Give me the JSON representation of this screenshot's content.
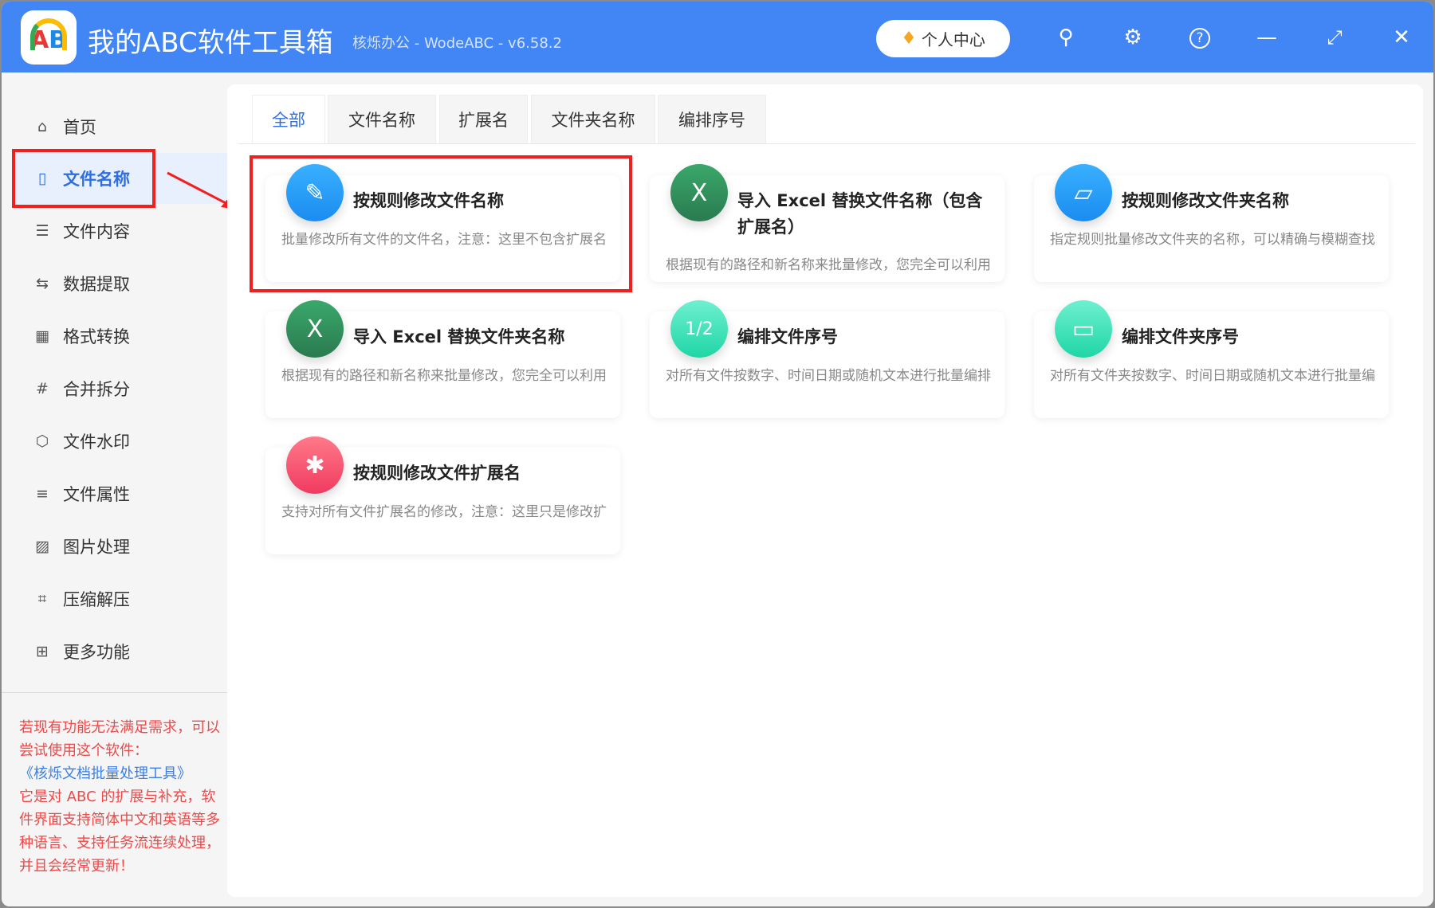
{
  "header": {
    "logo_text": "AB",
    "title": "我的ABC软件工具箱",
    "subtitle": "核烁办公 - WodeABC - v6.58.2",
    "vip_label": "个人中心",
    "icons": [
      "search-icon",
      "gear-icon",
      "help-icon",
      "minimize-icon",
      "maximize-icon",
      "close-icon"
    ]
  },
  "sidebar": {
    "items": [
      {
        "label": "首页",
        "icon": "⌂"
      },
      {
        "label": "文件名称",
        "icon": "▯"
      },
      {
        "label": "文件内容",
        "icon": "☰"
      },
      {
        "label": "数据提取",
        "icon": "⇆"
      },
      {
        "label": "格式转换",
        "icon": "▦"
      },
      {
        "label": "合并拆分",
        "icon": "#"
      },
      {
        "label": "文件水印",
        "icon": "⬡"
      },
      {
        "label": "文件属性",
        "icon": "≡"
      },
      {
        "label": "图片处理",
        "icon": "▨"
      },
      {
        "label": "压缩解压",
        "icon": "⌗"
      },
      {
        "label": "更多功能",
        "icon": "⊞"
      }
    ],
    "active_index": 1,
    "promo": {
      "line1": "若现有功能无法满足需求，可以尝试使用这个软件：",
      "link": "《核烁文档批量处理工具》",
      "line2": "它是对 ABC 的扩展与补充，软件界面支持简体中文和英语等多种语言、支持任务流连续处理，并且会经常更新！"
    }
  },
  "tabs": [
    "全部",
    "文件名称",
    "扩展名",
    "文件夹名称",
    "编排序号"
  ],
  "active_tab": 0,
  "cards": [
    {
      "title": "按规则修改文件名称",
      "desc": "批量修改所有文件的文件名，注意：这里不包含扩展名",
      "color": "#1e9bf5"
    },
    {
      "title": "导入 Excel 替换文件名称（包含扩展名）",
      "desc": "根据现有的路径和新名称来批量修改，您完全可以利用Excel",
      "color": "#2e8b57"
    },
    {
      "title": "按规则修改文件夹名称",
      "desc": "指定规则批量修改文件夹的名称，可以精确与模糊查找",
      "color": "#1e9bf5"
    },
    {
      "title": "导入 Excel 替换文件夹名称",
      "desc": "根据现有的路径和新名称来批量修改，您完全可以利用Excel",
      "color": "#2e8b57"
    },
    {
      "title": "编排文件序号",
      "desc": "对所有文件按数字、时间日期或随机文本进行批量编排",
      "color": "#2fd8b0"
    },
    {
      "title": "编排文件夹序号",
      "desc": "对所有文件夹按数字、时间日期或随机文本进行批量编排",
      "color": "#2fd8b0"
    },
    {
      "title": "按规则修改文件扩展名",
      "desc": "支持对所有文件扩展名的修改，注意：这里只是修改扩展名",
      "color": "#f24b6a"
    }
  ]
}
